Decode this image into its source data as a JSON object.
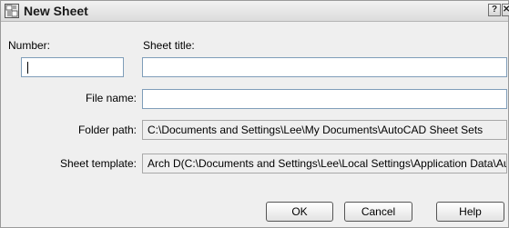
{
  "window": {
    "title": "New Sheet",
    "help_glyph": "?",
    "close_glyph": "✕"
  },
  "labels": {
    "number": "Number:",
    "sheet_title": "Sheet title:",
    "file_name": "File name:",
    "folder_path": "Folder path:",
    "sheet_template": "Sheet template:"
  },
  "fields": {
    "number": "",
    "sheet_title": "",
    "file_name": "",
    "folder_path": "C:\\Documents and Settings\\Lee\\My Documents\\AutoCAD Sheet Sets",
    "sheet_template": "Arch D(C:\\Documents and Settings\\Lee\\Local Settings\\Application Data\\Autodesk"
  },
  "buttons": {
    "ok": "OK",
    "cancel": "Cancel",
    "help": "Help"
  },
  "icons": {
    "app": "sheet-set-icon",
    "help": "help-icon",
    "close": "close-icon"
  }
}
